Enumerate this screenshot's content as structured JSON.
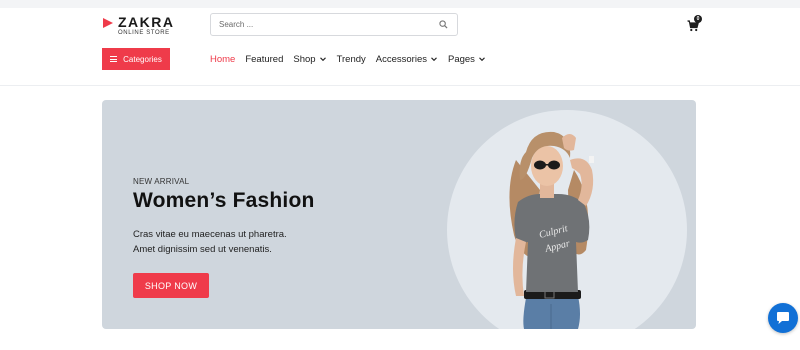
{
  "brand": {
    "name": "ZAKRA",
    "tagline": "ONLINE STORE",
    "accent": "#ef3b4a"
  },
  "search": {
    "placeholder": "Search ..."
  },
  "cart": {
    "count": "0"
  },
  "categories": {
    "label": "Categories"
  },
  "nav": {
    "items": [
      {
        "label": "Home",
        "active": true,
        "dropdown": false
      },
      {
        "label": "Featured",
        "active": false,
        "dropdown": false
      },
      {
        "label": "Shop",
        "active": false,
        "dropdown": true
      },
      {
        "label": "Trendy",
        "active": false,
        "dropdown": false
      },
      {
        "label": "Accessories",
        "active": false,
        "dropdown": true
      },
      {
        "label": "Pages",
        "active": false,
        "dropdown": true
      }
    ]
  },
  "hero": {
    "kicker": "NEW ARRIVAL",
    "title": "Women’s Fashion",
    "line1": "Cras vitae eu maecenas ut pharetra.",
    "line2": "Amet dignissim sed ut venenatis.",
    "cta": "SHOP NOW",
    "shirt_text_1": "Culprit",
    "shirt_text_2": "Appar"
  },
  "icons": {
    "search": "search-icon",
    "cart": "cart-icon",
    "menu": "hamburger-icon",
    "chevron": "chevron-down-icon",
    "chat": "chat-icon"
  }
}
